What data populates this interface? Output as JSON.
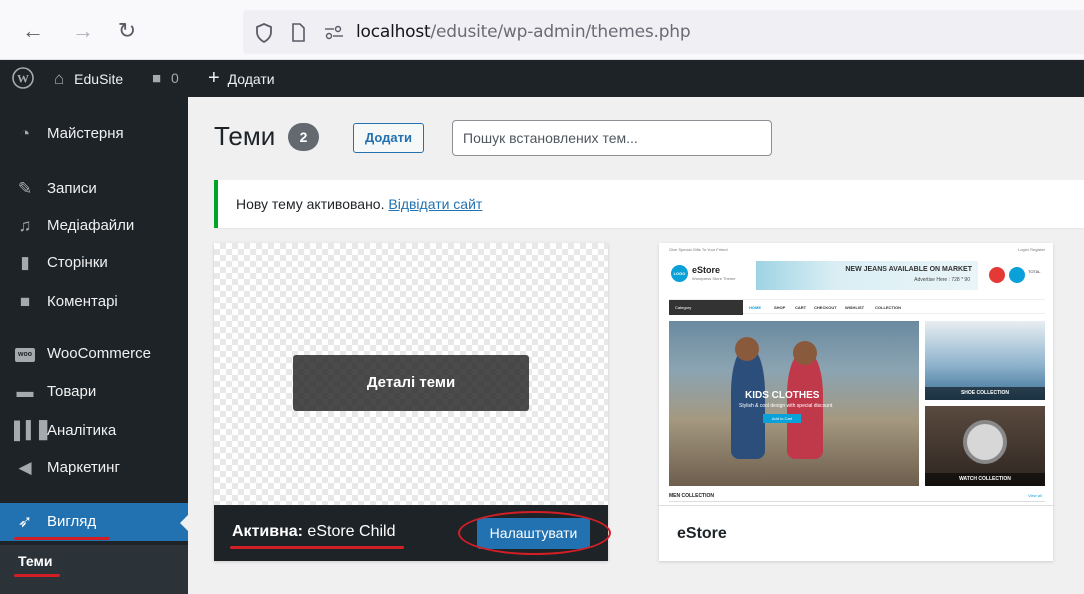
{
  "browser": {
    "url_host": "localhost",
    "url_path": "/edusite/wp-admin/themes.php"
  },
  "adminbar": {
    "site_name": "EduSite",
    "comments_count": "0",
    "new_label": "Додати"
  },
  "sidebar": {
    "items": [
      {
        "label": "Майстерня",
        "icon": "dashboard-icon"
      },
      {
        "label": "Записи",
        "icon": "pin-icon"
      },
      {
        "label": "Медіафайли",
        "icon": "media-icon"
      },
      {
        "label": "Сторінки",
        "icon": "page-icon"
      },
      {
        "label": "Коментарі",
        "icon": "comment-icon"
      },
      {
        "label": "WooCommerce",
        "icon": "woo-icon"
      },
      {
        "label": "Товари",
        "icon": "archive-icon"
      },
      {
        "label": "Аналітика",
        "icon": "chart-icon"
      },
      {
        "label": "Маркетинг",
        "icon": "megaphone-icon"
      },
      {
        "label": "Вигляд",
        "icon": "brush-icon"
      }
    ],
    "submenu_current": "Теми"
  },
  "main": {
    "title": "Теми",
    "count": "2",
    "add_label": "Додати",
    "search_placeholder": "Пошук встановлених тем...",
    "notice_text": "Нову тему активовано.",
    "notice_link": "Відвідати сайт"
  },
  "themes": {
    "active": {
      "details_label": "Деталі теми",
      "active_prefix": "Активна:",
      "name": "eStore Child",
      "customize_label": "Налаштувати"
    },
    "other": {
      "name": "eStore"
    }
  },
  "estore_preview": {
    "topline": "Give Special Gifts To Your Friend",
    "login": "Login/ Register",
    "brand": "eStore",
    "tagline": "Wordpress Store Theme",
    "logo": "LOGO",
    "ad_title": "NEW JEANS AVAILABLE ON MARKET",
    "ad_sub": "Advertise Here : 728 * 90",
    "total": "TOTAL",
    "category": "Category",
    "nav": [
      "HOME",
      "SHOP",
      "CART",
      "CHECKOUT",
      "WISHLIST",
      "COLLECTION"
    ],
    "hero_title": "KIDS CLOTHES",
    "hero_sub": "Stylish & cool design with special discount",
    "hero_btn": "Add to Cart",
    "shoe": "SHOE COLLECTION",
    "watch": "WATCH COLLECTION",
    "men": "MEN COLLECTION",
    "view_all": "View all"
  },
  "colors": {
    "wp_dark": "#1d2327",
    "wp_blue": "#2271b1",
    "notice_green": "#00a32a",
    "annotation_red": "#d21f26"
  }
}
